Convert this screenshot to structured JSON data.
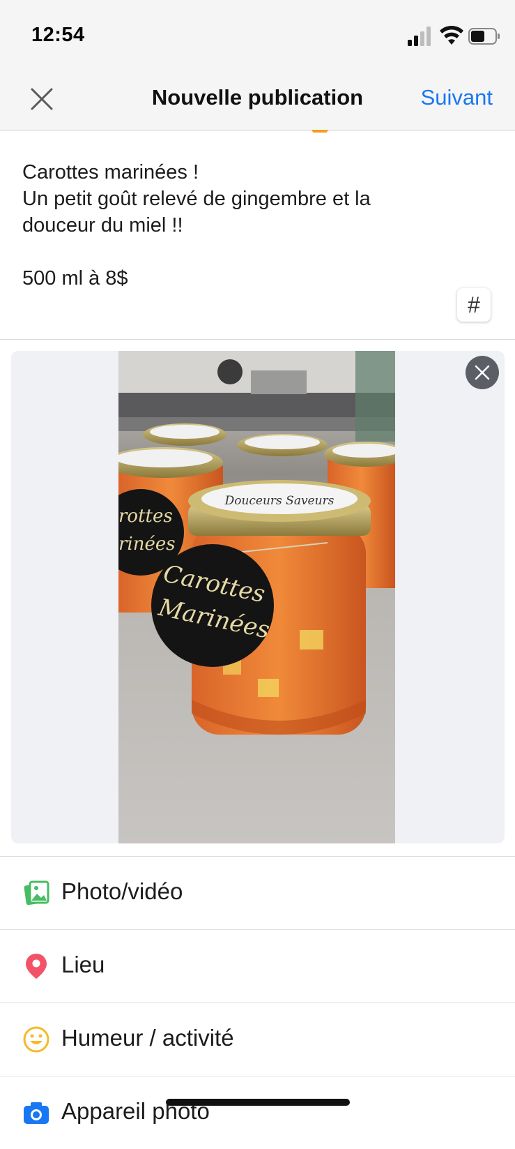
{
  "status_bar": {
    "time": "12:54"
  },
  "header": {
    "title": "Nouvelle publication",
    "next_label": "Suivant"
  },
  "post": {
    "lines": [
      "Carottes marinées !",
      "Un petit goût relevé de gingembre et la",
      "douceur du miel !!",
      "",
      "500 ml à 8$"
    ],
    "hashtag_label": "#"
  },
  "photo": {
    "lid_label": "Douceurs Saveurs",
    "tag_line1": "Carottes",
    "tag_line2": "Marinées",
    "side_tag_line1": "rottes",
    "side_tag_line2": "rinées"
  },
  "options": [
    {
      "label": "Photo/vidéo",
      "icon": "photo-icon",
      "color": "#45bd62"
    },
    {
      "label": "Lieu",
      "icon": "location-pin-icon",
      "color": "#f35369"
    },
    {
      "label": "Humeur / activité",
      "icon": "smiley-icon",
      "color": "#f7b928"
    },
    {
      "label": "Appareil photo",
      "icon": "camera-icon",
      "color": "#1877f2"
    }
  ]
}
